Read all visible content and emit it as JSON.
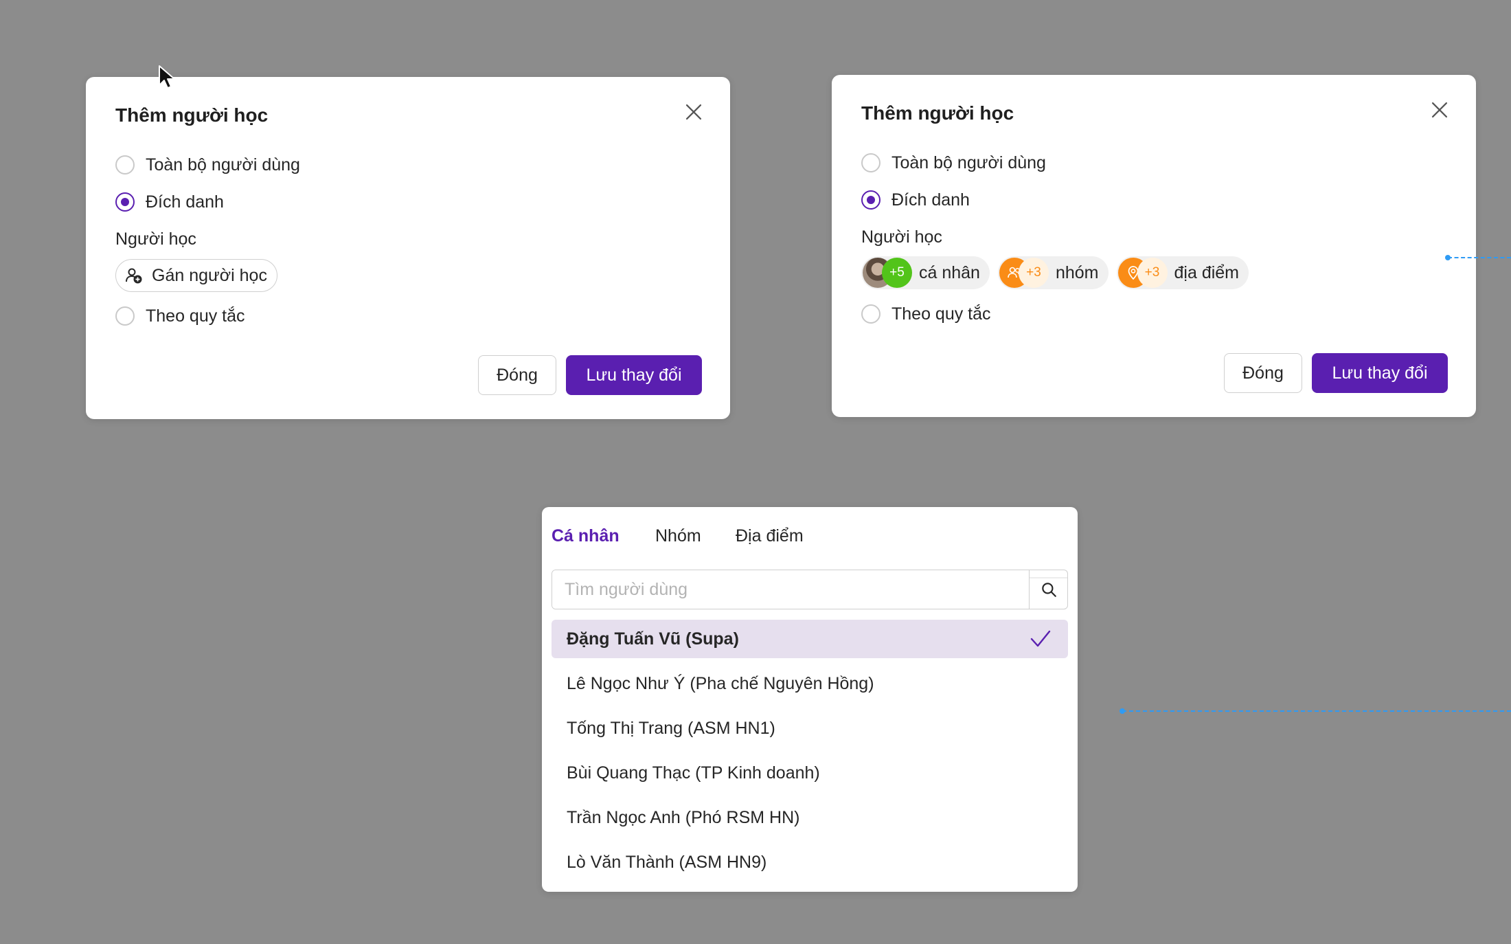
{
  "modal_a": {
    "title": "Thêm người học",
    "options": [
      "Toàn bộ người dùng",
      "Đích danh",
      "Theo quy tắc"
    ],
    "selected_option": "Đích danh",
    "learner_label": "Người học",
    "assign_label": "Gán người học",
    "close_label": "Đóng",
    "save_label": "Lưu thay đổi"
  },
  "modal_b": {
    "title": "Thêm người học",
    "options": [
      "Toàn bộ người dùng",
      "Đích danh",
      "Theo quy tắc"
    ],
    "selected_option": "Đích danh",
    "learner_label": "Người học",
    "chips": [
      {
        "count": "+5",
        "label": "cá nhân",
        "icon": "avatar-photo"
      },
      {
        "count": "+3",
        "label": "nhóm",
        "icon": "group-icon"
      },
      {
        "count": "+3",
        "label": "địa điểm",
        "icon": "location-icon"
      }
    ],
    "close_label": "Đóng",
    "save_label": "Lưu thay đổi"
  },
  "picker": {
    "tabs": [
      "Cá nhân",
      "Nhóm",
      "Địa điểm"
    ],
    "active_tab": "Cá nhân",
    "search_placeholder": "Tìm người dùng",
    "users": [
      {
        "name": "Đặng Tuấn Vũ (Supa)",
        "selected": true
      },
      {
        "name": "Lê Ngọc Như Ý (Pha chế Nguyên Hồng)",
        "selected": false
      },
      {
        "name": "Tống Thị Trang (ASM HN1)",
        "selected": false
      },
      {
        "name": "Bùi Quang Thạc (TP Kinh doanh)",
        "selected": false
      },
      {
        "name": "Trần Ngọc Anh (Phó RSM HN)",
        "selected": false
      },
      {
        "name": "Lò Văn Thành (ASM HN9)",
        "selected": false
      }
    ]
  },
  "colors": {
    "accent": "#5a1fb0",
    "selected_row": "#e6dfee",
    "chip_green": "#52c41a",
    "chip_orange": "#fa8c16",
    "background": "#8c8c8c",
    "annotation_line": "#2f9bf4"
  }
}
